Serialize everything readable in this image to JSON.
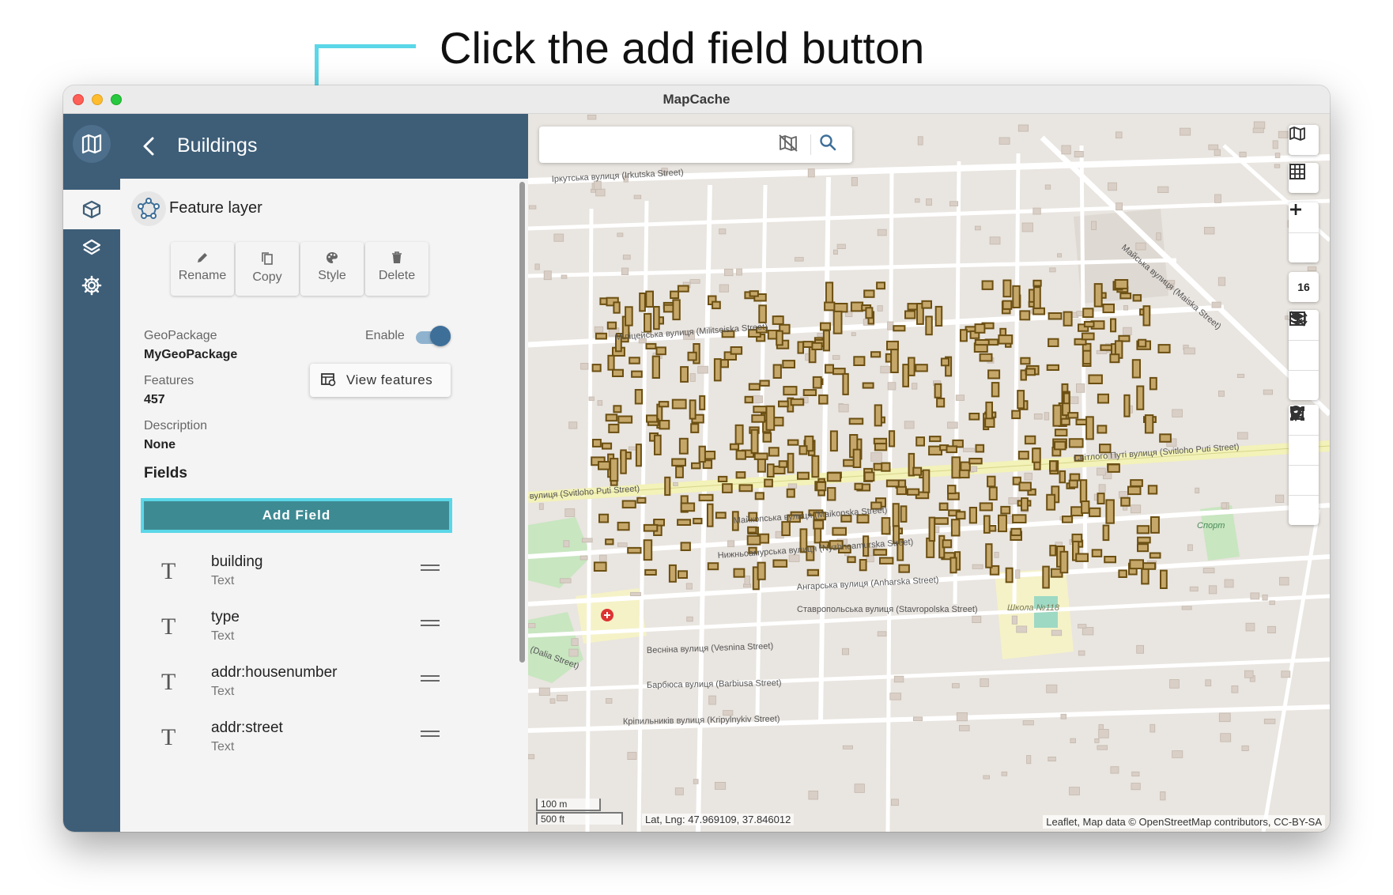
{
  "annotation": {
    "instruction": "Click the add field button"
  },
  "window": {
    "title": "MapCache"
  },
  "header": {
    "title": "Buildings"
  },
  "layer": {
    "type_label": "Feature layer"
  },
  "actions": {
    "rename": "Rename",
    "copy": "Copy",
    "style": "Style",
    "delete": "Delete"
  },
  "details": {
    "geopackage_label": "GeoPackage",
    "geopackage_value": "MyGeoPackage",
    "enable_label": "Enable",
    "enabled": true,
    "features_label": "Features",
    "features_value": "457",
    "description_label": "Description",
    "description_value": "None",
    "view_features": "View features"
  },
  "fields": {
    "heading": "Fields",
    "add_button": "Add Field",
    "items": [
      {
        "name": "building",
        "type": "Text",
        "icon": "text-type-icon"
      },
      {
        "name": "type",
        "type": "Text",
        "icon": "text-type-icon"
      },
      {
        "name": "addr:housenumber",
        "type": "Text",
        "icon": "text-type-icon"
      },
      {
        "name": "addr:street",
        "type": "Text",
        "icon": "text-type-icon"
      }
    ]
  },
  "map": {
    "search_placeholder": "",
    "zoom_level": "16",
    "scale_metric": "100 m",
    "scale_imperial": "500 ft",
    "lat_lng": "Lat, Lng: 47.969109, 37.846012",
    "attribution": "Leaflet, Map data © OpenStreetMap contributors, CC-BY-SA",
    "street_labels": {
      "irkutska": "Іркутська вулиця (Irkutska Street)",
      "militsejska": "Міліцейська вулиця (Militseiska Street)",
      "svitloho": "Світлого Путі вулиця (Svitloho Puti Street)",
      "svitloho_left": "вулиця (Svitloho Puti Street)",
      "majkopska": "Майкопська вулиця (Maikopska Street)",
      "nyzhnoamurska": "Нижньоамурська вулиця (Nyzhnoamurska Street)",
      "anharska": "Ангарська вулиця (Anharska Street)",
      "stavropolska": "Ставропольська вулиця (Stavropolska Street)",
      "vesnina": "Весніна вулиця (Vesnina Street)",
      "barbiusa": "Барбюса вулиця (Barbiusa Street)",
      "kripylnykiv": "Кріпильників вулиця (Kripylnykiv Street)",
      "dalia": "(Dalia Street)",
      "majska": "Майська вулиця (Maiska Street)",
      "school": "Школа №118",
      "sport": "Спорт"
    },
    "colors": {
      "building_fill": "#c6a76a",
      "building_stroke": "#6b4f12",
      "road": "#ffffff",
      "main_road": "#f3f2b8",
      "park": "#c8e6c0"
    }
  },
  "sidebar": {
    "items": [
      {
        "name": "feature-layer-nav",
        "icon": "cube-icon",
        "active": true
      },
      {
        "name": "layers-nav",
        "icon": "layers-icon",
        "active": false
      },
      {
        "name": "settings-nav",
        "icon": "gear-icon",
        "active": false
      }
    ]
  }
}
